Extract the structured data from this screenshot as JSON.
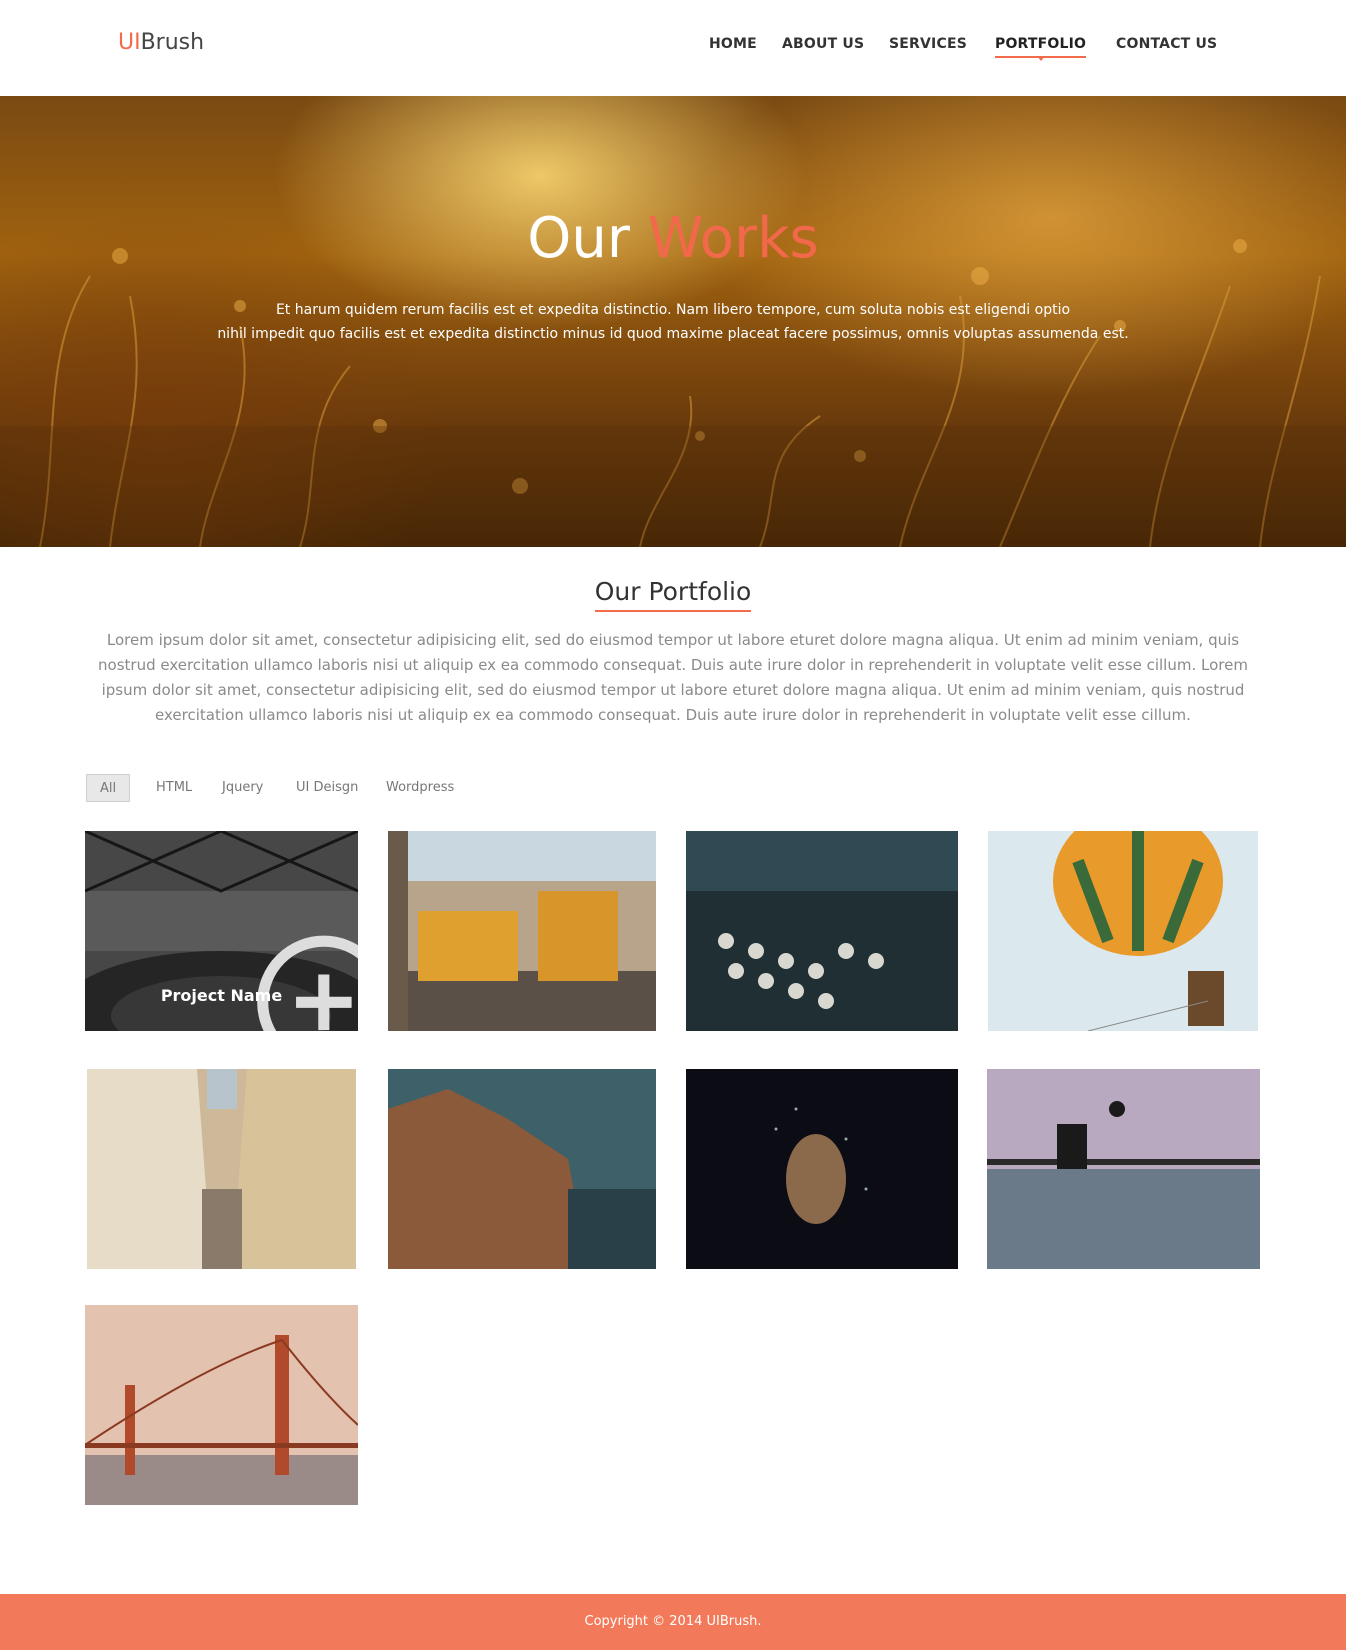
{
  "brand": {
    "prefix": "UI",
    "suffix": "Brush"
  },
  "nav": {
    "home": "HOME",
    "about": "ABOUT US",
    "services": "SERVICES",
    "portfolio": "PORTFOLIO",
    "contact": "CONTACT US"
  },
  "hero": {
    "title_white": "Our ",
    "title_accent": "Works",
    "text_line1": "Et harum quidem rerum facilis est et expedita distinctio. Nam libero tempore, cum soluta nobis est eligendi optio",
    "text_line2": "nihil impedit quo facilis est et expedita distinctio minus id quod maxime placeat facere possimus, omnis voluptas assumenda est."
  },
  "portfolio": {
    "title": "Our Portfolio",
    "description": "Lorem ipsum dolor sit amet, consectetur adipisicing elit, sed do eiusmod tempor  ut labore eturet dolore magna aliqua. Ut enim ad minim veniam, quis nostrud exercitation ullamco laboris nisi ut aliquip ex ea commodo consequat. Duis aute irure dolor in reprehenderit in voluptate velit esse cillum.  Lorem ipsum dolor sit amet, consectetur adipisicing elit, sed do eiusmod tempor  ut labore eturet dolore magna aliqua. Ut enim ad minim veniam, quis nostrud exercitation ullamco laboris nisi ut aliquip ex ea commodo consequat. Duis aute irure dolor in reprehenderit in voluptate velit esse cillum.",
    "filters": [
      "All",
      "HTML",
      "Jquery",
      "UI Deisgn",
      "Wordpress"
    ],
    "hover_label": "Project Name"
  },
  "footer": {
    "copyright": "Copyright © 2014 UIBrush."
  },
  "colors": {
    "accent": "#f26b4a",
    "footer": "#f27a5a"
  },
  "icons": {
    "zoom": "zoom-in-icon"
  }
}
